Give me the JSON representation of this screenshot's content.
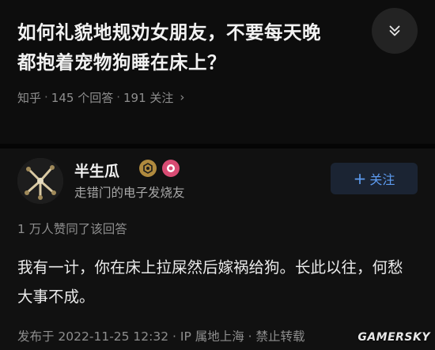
{
  "question": {
    "title_line1": "如何礼貌地规劝女朋友，不要每天晚",
    "title_line2": "都抱着宠物狗睡在床上？",
    "source": "知乎",
    "answers_count": "145 个回答",
    "followers_count": "191 关注",
    "dot": "·",
    "chevron": "›"
  },
  "collapse_icon": "chevron-double-down-icon",
  "answer": {
    "author_name": "半生瓜",
    "author_bio": "走错门的电子发烧友",
    "follow_label": "关注",
    "follow_plus": "+",
    "upvotes": "1 万人赞同了该回答",
    "body": "我有一计，你在床上拉屎然后嫁祸给狗。长此以往，何愁大事不成。",
    "meta": "发布于 2022-11-25 12:32 · IP 属地上海 · 禁止转载"
  },
  "watermark": "GAMERSKY",
  "colors": {
    "background": "#0b0b0b",
    "follow_accent": "#5d9bf0",
    "badge_gold": "#b08a3e",
    "badge_pink": "#d84b73"
  }
}
